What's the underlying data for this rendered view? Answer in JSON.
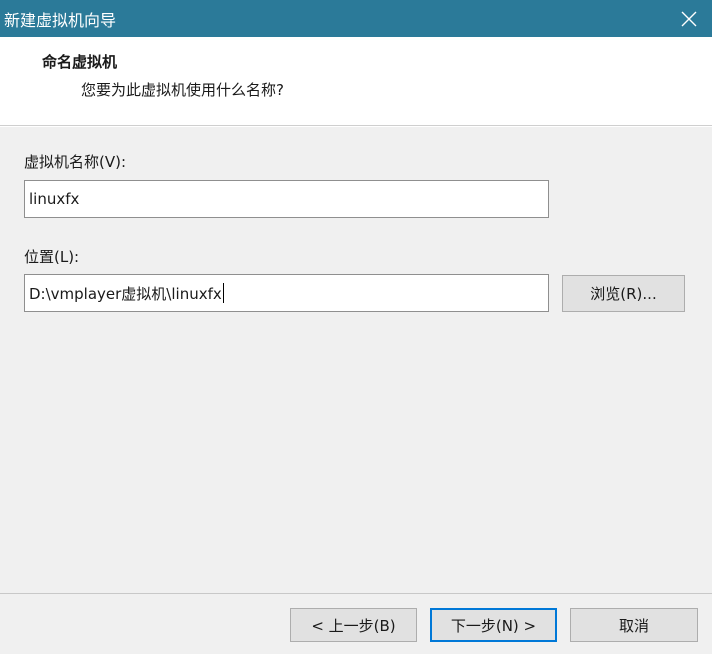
{
  "window": {
    "title": "新建虚拟机向导"
  },
  "header": {
    "heading": "命名虚拟机",
    "subtitle": "您要为此虚拟机使用什么名称?"
  },
  "form": {
    "name_label": "虚拟机名称(V):",
    "name_value": "linuxfx",
    "location_label": "位置(L):",
    "location_value": "D:\\vmplayer虚拟机\\linuxfx",
    "browse_label": "浏览(R)..."
  },
  "footer": {
    "back_label": "< 上一步(B)",
    "next_label": "下一步(N) >",
    "cancel_label": "取消"
  },
  "colors": {
    "titlebar": "#2b7a99",
    "accent": "#0078d7"
  },
  "icons": {
    "close": "close-icon"
  }
}
